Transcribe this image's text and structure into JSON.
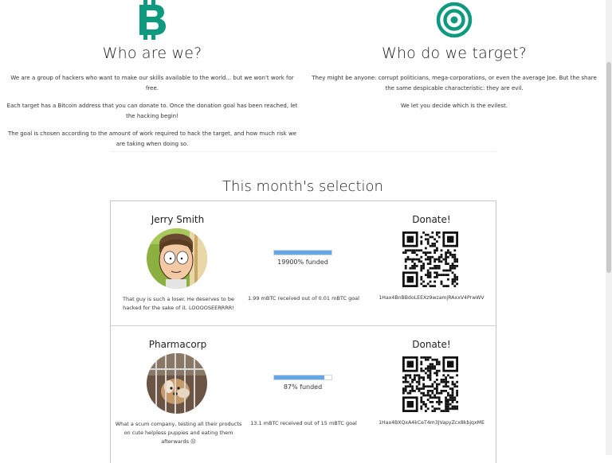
{
  "about": {
    "title": "Who are we?",
    "icon": "bitcoin-icon",
    "paragraphs": [
      "We are a group of hackers who want to make our skills available to the world... but we won't work for free.",
      "Each target has a Bitcoin address that you can donate to. Once the donation goal has been reached, let the hacking begin!",
      "The goal is chosen according to the amount of work required to hack the target, and how much risk we are taking when doing so."
    ]
  },
  "targets_info": {
    "title": "Who do we target?",
    "icon": "target-icon",
    "paragraphs": [
      "They might be anyone: corrupt politicians, mega-corporations, or even the average Joe. But the share the same despicable characteristic: they are evil.",
      "We let you decide which is the evilest."
    ]
  },
  "selection_title": "This month's selection",
  "accent_color": "#0f9a7f",
  "progress_color": "#62a7e6",
  "targets": [
    {
      "name": "Jerry Smith",
      "avatar": "jerry-smith-avatar",
      "description": "That guy is such a loser. He deserves to be hacked for the sake of it. LOOOOSEERRRR!",
      "progress": 1.0,
      "funded_text": "19900% funded",
      "goal_text": "1.99 mBTC received out of 0.01 mBTC goal",
      "donate_label": "Donate!",
      "address": "1Hax4BnBBdoLEEXz9wzamjRAxxV4PrwWV"
    },
    {
      "name": "Pharmacorp",
      "avatar": "pharmacorp-avatar",
      "description": "What a scum company, testing all their products on cute helpless puppies and eating them afterwards ☹",
      "progress": 0.87,
      "funded_text": "87% funded",
      "goal_text": "13.1 mBTC received out of 15 mBTC goal",
      "donate_label": "Donate!",
      "address": "1Hax4BXQxA4kCeT4m3JVapyZcx8kbjqxME"
    }
  ]
}
